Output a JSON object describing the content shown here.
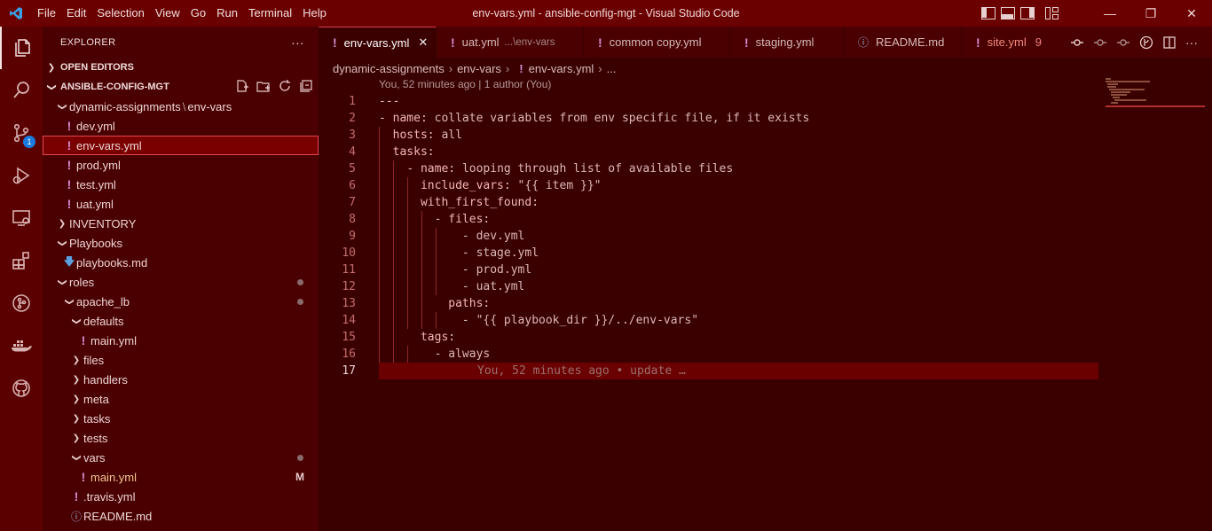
{
  "window": {
    "title": "env-vars.yml - ansible-config-mgt - Visual Studio Code",
    "menu": [
      "File",
      "Edit",
      "Selection",
      "View",
      "Go",
      "Run",
      "Terminal",
      "Help"
    ]
  },
  "activity": {
    "source_control_badge": "1"
  },
  "sidebar": {
    "title": "EXPLORER",
    "more": "···",
    "open_editors": "OPEN EDITORS",
    "workspace": "ANSIBLE-CONFIG-MGT",
    "tree": {
      "dynamic_folder": "dynamic-assignments",
      "dynamic_sep": "\\",
      "env_vars_folder": "env-vars",
      "dev": "dev.yml",
      "env_vars_file": "env-vars.yml",
      "prod": "prod.yml",
      "test": "test.yml",
      "uat": "uat.yml",
      "inventory": "INVENTORY",
      "playbooks": "Playbooks",
      "playbooks_md": "playbooks.md",
      "roles": "roles",
      "apache_lb": "apache_lb",
      "defaults": "defaults",
      "defaults_main": "main.yml",
      "files": "files",
      "handlers": "handlers",
      "meta": "meta",
      "tasks": "tasks",
      "tests": "tests",
      "vars": "vars",
      "vars_main": "main.yml",
      "vars_main_status": "M",
      "travis": ".travis.yml",
      "readme": "README.md"
    }
  },
  "tabs": [
    {
      "label": "env-vars.yml",
      "close": "✕"
    },
    {
      "label": "uat.yml",
      "desc": "...\\env-vars"
    },
    {
      "label": "common copy.yml"
    },
    {
      "label": "staging.yml"
    },
    {
      "label": "README.md"
    },
    {
      "label": "site.yml",
      "count": "9"
    }
  ],
  "breadcrumb": {
    "part1": "dynamic-assignments",
    "part2": "env-vars",
    "part3": "env-vars.yml",
    "part4": "..."
  },
  "codelens": "You, 52 minutes ago | 1 author (You)",
  "editor": {
    "line_numbers": [
      "1",
      "2",
      "3",
      "4",
      "5",
      "6",
      "7",
      "8",
      "9",
      "10",
      "11",
      "12",
      "13",
      "14",
      "15",
      "16",
      "17"
    ],
    "l1": "---",
    "l2_key": "name",
    "l2_val": "collate variables from env specific file, if it exists",
    "l3_key": "hosts",
    "l3_val": "all",
    "l4_key": "tasks",
    "l5_key": "name",
    "l5_val": "looping through list of available files",
    "l6_key": "include_vars",
    "l6_val": "\"{{ item }}\"",
    "l7_key": "with_first_found",
    "l8_key": "files",
    "l9_val": "dev.yml",
    "l10_val": "stage.yml",
    "l11_val": "prod.yml",
    "l12_val": "uat.yml",
    "l13_key": "paths",
    "l14_val": "\"{{ playbook_dir }}/../env-vars\"",
    "l15_key": "tags",
    "l16_val": "always",
    "blame": "You, 52 minutes ago • update …"
  }
}
